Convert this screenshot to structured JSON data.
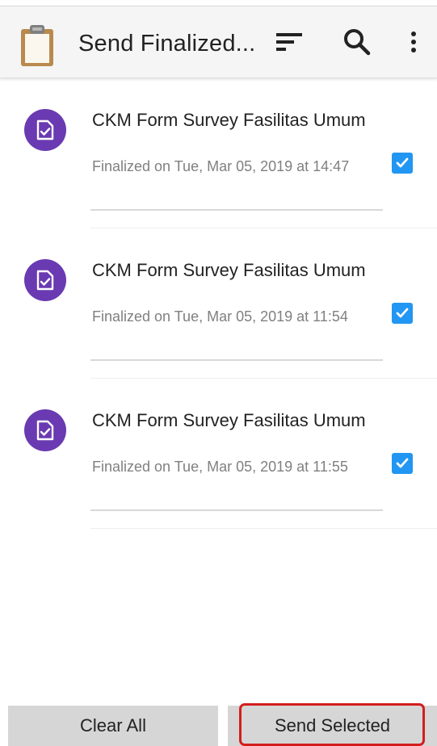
{
  "toolbar": {
    "title": "Send Finalized...",
    "app_icon": "clipboard-icon",
    "actions": [
      "sort-icon",
      "search-icon",
      "more-vert-icon"
    ]
  },
  "forms": [
    {
      "title": "CKM Form Survey Fasilitas Umum",
      "subtitle": "Finalized on Tue, Mar 05, 2019 at 14:47",
      "checked": true,
      "icon": "form-check-icon"
    },
    {
      "title": "CKM Form Survey Fasilitas Umum",
      "subtitle": "Finalized on Tue, Mar 05, 2019 at 11:54",
      "checked": true,
      "icon": "form-check-icon"
    },
    {
      "title": "CKM Form Survey Fasilitas Umum",
      "subtitle": "Finalized on Tue, Mar 05, 2019 at 11:55",
      "checked": true,
      "icon": "form-check-icon"
    }
  ],
  "buttons": {
    "clear_all": "Clear All",
    "send_selected": "Send Selected"
  },
  "colors": {
    "accent_purple": "#6a3ab2",
    "checkbox_blue": "#2196f3",
    "highlight_red": "#d41d1d",
    "button_gray": "#d6d6d6"
  }
}
